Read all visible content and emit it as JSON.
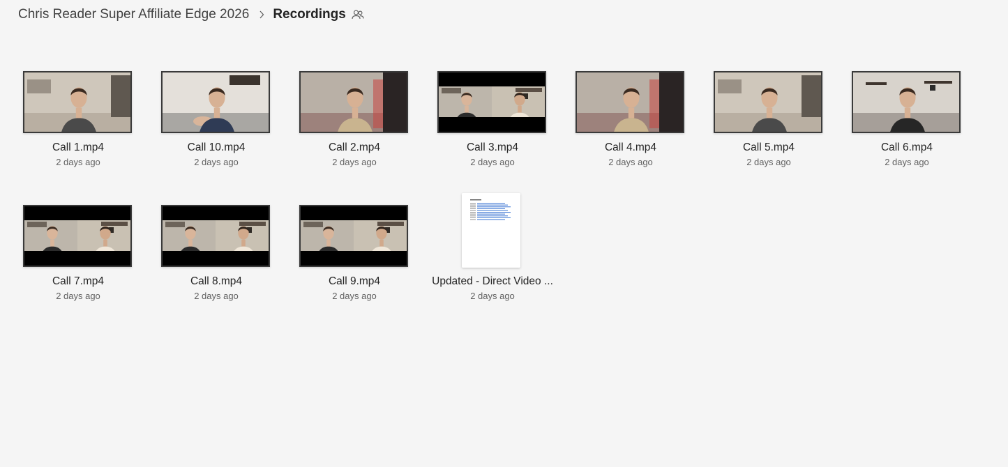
{
  "breadcrumb": {
    "parent": "Chris Reader Super Affiliate Edge 2026",
    "current": "Recordings",
    "separator_icon": "chevron-right-icon",
    "shared_icon": "people-icon"
  },
  "files": [
    {
      "name": "Call 1.mp4",
      "modified": "2 days ago",
      "kind": "video",
      "variant": "solo-room"
    },
    {
      "name": "Call 10.mp4",
      "modified": "2 days ago",
      "kind": "video",
      "variant": "solo-hand"
    },
    {
      "name": "Call 2.mp4",
      "modified": "2 days ago",
      "kind": "video",
      "variant": "solo-red"
    },
    {
      "name": "Call 3.mp4",
      "modified": "2 days ago",
      "kind": "video",
      "variant": "dual"
    },
    {
      "name": "Call 4.mp4",
      "modified": "2 days ago",
      "kind": "video",
      "variant": "solo-red"
    },
    {
      "name": "Call 5.mp4",
      "modified": "2 days ago",
      "kind": "video",
      "variant": "solo-room"
    },
    {
      "name": "Call 6.mp4",
      "modified": "2 days ago",
      "kind": "video",
      "variant": "solo-shelf"
    },
    {
      "name": "Call 7.mp4",
      "modified": "2 days ago",
      "kind": "video",
      "variant": "dual"
    },
    {
      "name": "Call 8.mp4",
      "modified": "2 days ago",
      "kind": "video",
      "variant": "dual"
    },
    {
      "name": "Call 9.mp4",
      "modified": "2 days ago",
      "kind": "video",
      "variant": "dual"
    },
    {
      "name": "Updated - Direct Video ...",
      "modified": "2 days ago",
      "kind": "document",
      "variant": "doc"
    }
  ],
  "colors": {
    "background": "#f5f5f5",
    "link_blue": "#4a7fd6"
  }
}
